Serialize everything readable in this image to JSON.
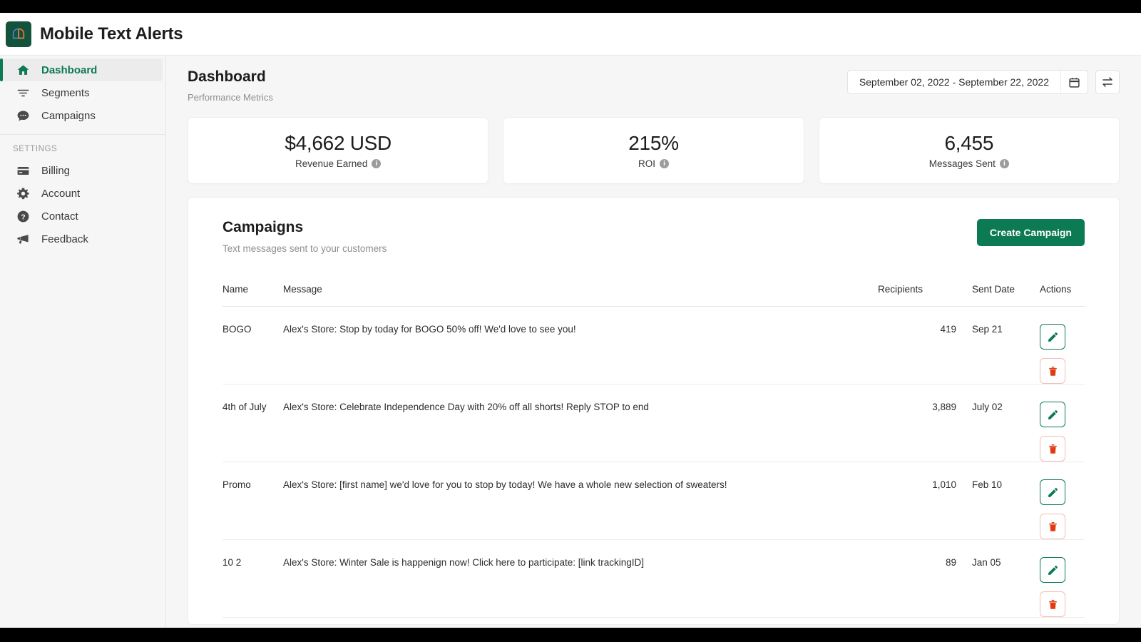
{
  "brand": {
    "name": "Mobile Text Alerts",
    "logo_icon": "mta-logo-icon",
    "logo_bg": "#14533b"
  },
  "sidebar": {
    "primary_items": [
      {
        "label": "Dashboard",
        "icon": "home-icon",
        "active": true
      },
      {
        "label": "Segments",
        "icon": "filter-icon",
        "active": false
      },
      {
        "label": "Campaigns",
        "icon": "chat-bubble-icon",
        "active": false
      }
    ],
    "section_title": "SETTINGS",
    "settings_items": [
      {
        "label": "Billing",
        "icon": "credit-card-icon"
      },
      {
        "label": "Account",
        "icon": "gear-icon"
      },
      {
        "label": "Contact",
        "icon": "question-circle-icon"
      },
      {
        "label": "Feedback",
        "icon": "megaphone-icon"
      }
    ]
  },
  "header": {
    "title": "Dashboard",
    "subtitle": "Performance Metrics",
    "date_range": "September 02, 2022 - September 22, 2022",
    "calendar_icon": "calendar-icon",
    "compare_icon": "compare-arrows-icon"
  },
  "metrics": [
    {
      "value": "$4,662 USD",
      "label": "Revenue Earned",
      "info_icon": "info-icon"
    },
    {
      "value": "215%",
      "label": "ROI",
      "info_icon": "info-icon"
    },
    {
      "value": "6,455",
      "label": "Messages Sent",
      "info_icon": "info-icon"
    }
  ],
  "campaigns": {
    "title": "Campaigns",
    "subtitle": "Text messages sent to your customers",
    "create_button": "Create Campaign",
    "columns": [
      "Name",
      "Message",
      "Recipients",
      "Sent Date",
      "Actions"
    ],
    "rows": [
      {
        "name": "BOGO",
        "message": "Alex's Store: Stop by today for BOGO 50% off! We'd love to see you!",
        "recipients": "419",
        "sent_date": "Sep 21",
        "edit_icon": "pencil-icon",
        "delete_icon": "trash-icon"
      },
      {
        "name": "4th of July",
        "message": "Alex's Store: Celebrate Independence Day with 20% off all shorts! Reply STOP to end",
        "recipients": "3,889",
        "sent_date": "July 02",
        "edit_icon": "pencil-icon",
        "delete_icon": "trash-icon"
      },
      {
        "name": "Promo",
        "message": "Alex's Store: [first name] we'd love for you to stop by today! We have a whole new selection of sweaters!",
        "recipients": "1,010",
        "sent_date": "Feb 10",
        "edit_icon": "pencil-icon",
        "delete_icon": "trash-icon"
      },
      {
        "name": "10 2",
        "message": "Alex's Store: Winter Sale is happenign now! Click here to participate: [link trackingID]",
        "recipients": "89",
        "sent_date": "Jan 05",
        "edit_icon": "pencil-icon",
        "delete_icon": "trash-icon"
      }
    ]
  },
  "colors": {
    "brand_green": "#0c7a53",
    "logo_green": "#14533b",
    "delete_red": "#e23b13",
    "page_bg": "#f6f6f7"
  }
}
